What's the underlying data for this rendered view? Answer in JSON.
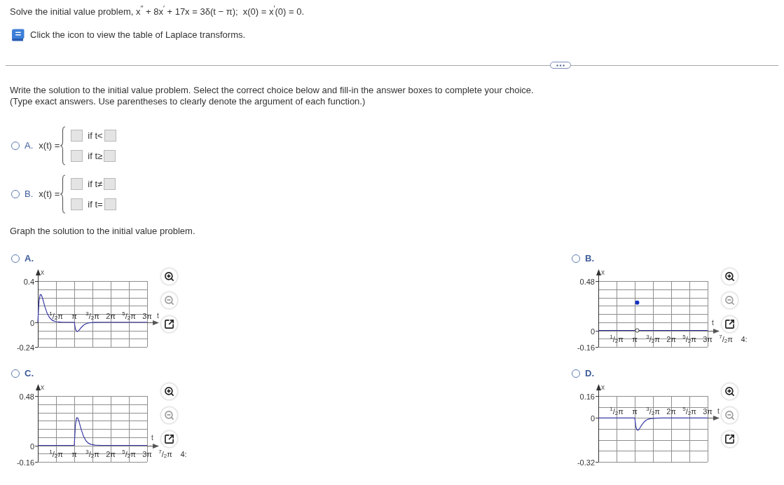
{
  "problem": {
    "statement": "Solve the initial value problem, x$^{′′}$ + 8x$^{′}$ + 17x = 3δ(t − π);  x(0) = x$^{′}$(0) = 0.",
    "table_link": "Click the icon to view the table of Laplace transforms."
  },
  "part_1": {
    "instructions": [
      "Write the solution to the initial value problem. Select the correct choice below and fill-in the answer boxes to complete your choice.",
      "(Type exact answers. Use parentheses to clearly denote the argument of each function.)"
    ],
    "choices": [
      {
        "letter": "A.",
        "selected": false,
        "lhs": "x(t) =",
        "cases": [
          {
            "condition": "if t<"
          },
          {
            "condition": "if t≥"
          }
        ]
      },
      {
        "letter": "B.",
        "selected": false,
        "lhs": "x(t) =",
        "cases": [
          {
            "condition": "if t≠"
          },
          {
            "condition": "if t="
          }
        ]
      }
    ]
  },
  "part_2": {
    "instruction": "Graph the solution to the initial value problem.",
    "choices": [
      {
        "letter": "A.",
        "selected": false,
        "tools": [
          {
            "kind": "zoom_in",
            "disabled": false
          },
          {
            "kind": "zoom_out",
            "disabled": true
          },
          {
            "kind": "popout",
            "disabled": false
          }
        ],
        "chart_data": {
          "type": "line",
          "xlabel": "t",
          "ylabel": "x",
          "xlim": [
            0,
            9.425
          ],
          "ylim": [
            -0.24,
            0.4
          ],
          "yticks": [
            0.4,
            {
              "value": 0.32,
              "label": null
            },
            {
              "value": 0.24,
              "label": null
            },
            {
              "value": 0.16,
              "label": null
            },
            {
              "value": 0.08,
              "label": null
            },
            0,
            {
              "value": -0.08,
              "label": null
            },
            {
              "value": -0.16,
              "label": null
            },
            -0.24
          ],
          "xticks": [
            {
              "value": 1.571,
              "label": "$^{1}$/$_{2}$π"
            },
            {
              "value": 3.142,
              "label": "π"
            },
            {
              "value": 4.712,
              "label": "$^{3}$/$_{2}$π"
            },
            {
              "value": 6.283,
              "label": "2π"
            },
            {
              "value": 7.854,
              "label": "$^{5}$/$_{2}$π"
            },
            {
              "value": 9.425,
              "label": "3π"
            }
          ],
          "grid": true,
          "series": [
            {
              "type": "line",
              "color": "#3a3aa6",
              "x": [
                0,
                0.1,
                0.2,
                0.3,
                0.4,
                0.5,
                0.6,
                0.8,
                1,
                1.2,
                1.4,
                1.6,
                2,
                2.5,
                3.142,
                3.242,
                3.342,
                3.442,
                3.542,
                3.642,
                3.742,
                3.942,
                4.142,
                4.342,
                4.542,
                4.942,
                5.5,
                9.425
              ],
              "values": [
                0,
                0.201,
                0.268,
                0.267,
                0.236,
                0.195,
                0.154,
                0.088,
                0.046,
                0.023,
                0.011,
                0.005,
                0.001,
                0,
                0,
                -0.067,
                -0.089,
                -0.089,
                -0.079,
                -0.065,
                -0.051,
                -0.029,
                -0.015,
                -0.008,
                -0.004,
                -0.001,
                0,
                0
              ]
            }
          ]
        }
      },
      {
        "letter": "B.",
        "selected": false,
        "tools": [
          {
            "kind": "zoom_in",
            "disabled": false
          },
          {
            "kind": "zoom_out",
            "disabled": true
          },
          {
            "kind": "popout",
            "disabled": false
          }
        ],
        "chart_data": {
          "type": "line",
          "xlabel": "t",
          "ylabel": "x",
          "xlim": [
            0,
            9.425
          ],
          "ylim": [
            -0.16,
            0.48
          ],
          "yticks": [
            0.48,
            {
              "value": 0.4,
              "label": null
            },
            {
              "value": 0.32,
              "label": null
            },
            {
              "value": 0.24,
              "label": null
            },
            {
              "value": 0.16,
              "label": null
            },
            {
              "value": 0.08,
              "label": null
            },
            0,
            {
              "value": -0.08,
              "label": null
            },
            -0.16
          ],
          "xticks": [
            {
              "value": 1.571,
              "label": "$^{1}$/$_{2}$π"
            },
            {
              "value": 3.142,
              "label": "π"
            },
            {
              "value": 4.712,
              "label": "$^{3}$/$_{2}$π"
            },
            {
              "value": 6.283,
              "label": "2π"
            },
            {
              "value": 7.854,
              "label": "$^{5}$/$_{2}$π"
            },
            {
              "value": 9.425,
              "label": "3π"
            }
          ],
          "annotations": [
            "$^{7}$/$_{2}$π",
            "4:"
          ],
          "grid": true,
          "series": [
            {
              "type": "line",
              "color": "#22228f",
              "x": [
                0,
                3.2,
                3.35,
                3.5,
                9.425
              ],
              "values": [
                0,
                0,
                null,
                0,
                0
              ]
            },
            {
              "type": "scatter",
              "marker": "circle",
              "color": "#1432c0",
              "x": [
                3.35
              ],
              "values": [
                0.27
              ]
            }
          ]
        }
      },
      {
        "letter": "C.",
        "selected": false,
        "tools": [
          {
            "kind": "zoom_in",
            "disabled": false
          },
          {
            "kind": "zoom_out",
            "disabled": true
          },
          {
            "kind": "popout",
            "disabled": false
          }
        ],
        "chart_data": {
          "type": "line",
          "xlabel": "t",
          "ylabel": "x",
          "xlim": [
            0,
            9.425
          ],
          "ylim": [
            -0.16,
            0.48
          ],
          "yticks": [
            0.48,
            {
              "value": 0.4,
              "label": null
            },
            {
              "value": 0.32,
              "label": null
            },
            {
              "value": 0.24,
              "label": null
            },
            {
              "value": 0.16,
              "label": null
            },
            {
              "value": 0.08,
              "label": null
            },
            0,
            {
              "value": -0.08,
              "label": null
            },
            -0.16
          ],
          "xticks": [
            {
              "value": 1.571,
              "label": "$^{1}$/$_{2}$π"
            },
            {
              "value": 3.142,
              "label": "π"
            },
            {
              "value": 4.712,
              "label": "$^{3}$/$_{2}$π"
            },
            {
              "value": 6.283,
              "label": "2π"
            },
            {
              "value": 7.854,
              "label": "$^{5}$/$_{2}$π"
            },
            {
              "value": 9.425,
              "label": "3π"
            }
          ],
          "annotations": [
            "$^{7}$/$_{2}$π",
            "4:"
          ],
          "grid": true,
          "series": [
            {
              "type": "line",
              "color": "#3a3aa6",
              "x": [
                0,
                3.142,
                3.242,
                3.342,
                3.442,
                3.542,
                3.642,
                3.742,
                3.942,
                4.142,
                4.342,
                4.542,
                4.942,
                5.5,
                9.425
              ],
              "values": [
                0,
                0,
                0.201,
                0.268,
                0.267,
                0.236,
                0.195,
                0.154,
                0.088,
                0.046,
                0.023,
                0.011,
                0.002,
                0,
                0
              ]
            }
          ]
        }
      },
      {
        "letter": "D.",
        "selected": false,
        "tools": [
          {
            "kind": "zoom_in",
            "disabled": false
          },
          {
            "kind": "zoom_out",
            "disabled": true
          },
          {
            "kind": "popout",
            "disabled": false
          }
        ],
        "chart_data": {
          "type": "line",
          "xlabel": "t",
          "ylabel": "x",
          "xlim": [
            0,
            9.425
          ],
          "ylim": [
            -0.32,
            0.16
          ],
          "yticks": [
            0.16,
            {
              "value": 0.08,
              "label": null
            },
            0,
            {
              "value": -0.08,
              "label": null
            },
            {
              "value": -0.16,
              "label": null
            },
            {
              "value": -0.24,
              "label": null
            },
            -0.32
          ],
          "xticks": [
            {
              "value": 1.571,
              "label": "$^{1}$/$_{2}$π"
            },
            {
              "value": 3.142,
              "label": "π"
            },
            {
              "value": 4.712,
              "label": "$^{3}$/$_{2}$π"
            },
            {
              "value": 6.283,
              "label": "2π"
            },
            {
              "value": 7.854,
              "label": "$^{5}$/$_{2}$π"
            },
            {
              "value": 9.425,
              "label": "3π"
            }
          ],
          "grid": true,
          "series": [
            {
              "type": "line",
              "color": "#3a3aa6",
              "x": [
                0,
                3.142,
                3.242,
                3.342,
                3.442,
                3.542,
                3.642,
                3.742,
                3.942,
                4.142,
                4.342,
                4.542,
                4.942,
                5.5,
                9.425
              ],
              "values": [
                0,
                0,
                -0.067,
                -0.089,
                -0.089,
                -0.079,
                -0.065,
                -0.051,
                -0.029,
                -0.015,
                -0.008,
                -0.004,
                -0.001,
                0,
                0
              ]
            }
          ]
        }
      }
    ]
  }
}
